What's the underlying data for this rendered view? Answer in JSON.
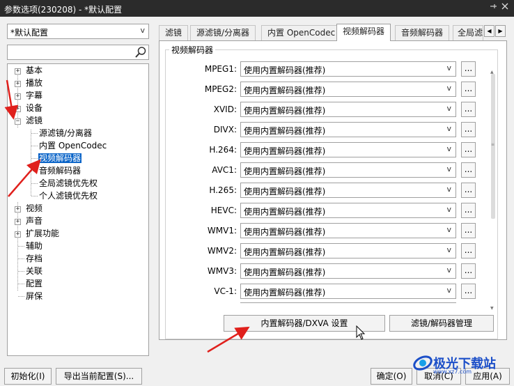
{
  "window": {
    "title": "参数选项(230208) - *默认配置",
    "pin_icon": "pin-icon",
    "close_icon": "close-icon"
  },
  "preset": {
    "value": "*默认配置"
  },
  "search": {
    "placeholder": ""
  },
  "tree": {
    "items": [
      {
        "label": "基本",
        "expander": "+"
      },
      {
        "label": "播放",
        "expander": "+"
      },
      {
        "label": "字幕",
        "expander": "+"
      },
      {
        "label": "设备",
        "expander": "+"
      },
      {
        "label": "滤镜",
        "expander": "−"
      },
      {
        "label": "源滤镜/分离器"
      },
      {
        "label": "内置 OpenCodec"
      },
      {
        "label": "视频解码器",
        "selected": true
      },
      {
        "label": "音频解码器"
      },
      {
        "label": "全局滤镜优先权"
      },
      {
        "label": "个人滤镜优先权"
      },
      {
        "label": "视频",
        "expander": "+"
      },
      {
        "label": "声音",
        "expander": "+"
      },
      {
        "label": "扩展功能",
        "expander": "+"
      },
      {
        "label": "辅助"
      },
      {
        "label": "存档"
      },
      {
        "label": "关联"
      },
      {
        "label": "配置"
      },
      {
        "label": "屏保"
      }
    ]
  },
  "tabs": [
    {
      "label": "滤镜"
    },
    {
      "label": "源滤镜/分离器"
    },
    {
      "label": "内置 OpenCodec"
    },
    {
      "label": "视频解码器",
      "active": true
    },
    {
      "label": "音频解码器"
    },
    {
      "label": "全局滤"
    }
  ],
  "panel": {
    "group_title": "视频解码器",
    "rows": [
      {
        "label": "MPEG1:",
        "value": "使用内置解码器(推荐)"
      },
      {
        "label": "MPEG2:",
        "value": "使用内置解码器(推荐)"
      },
      {
        "label": "XVID:",
        "value": "使用内置解码器(推荐)"
      },
      {
        "label": "DIVX:",
        "value": "使用内置解码器(推荐)"
      },
      {
        "label": "H.264:",
        "value": "使用内置解码器(推荐)"
      },
      {
        "label": "AVC1:",
        "value": "使用内置解码器(推荐)"
      },
      {
        "label": "H.265:",
        "value": "使用内置解码器(推荐)"
      },
      {
        "label": "HEVC:",
        "value": "使用内置解码器(推荐)"
      },
      {
        "label": "WMV1:",
        "value": "使用内置解码器(推荐)"
      },
      {
        "label": "WMV2:",
        "value": "使用内置解码器(推荐)"
      },
      {
        "label": "WMV3:",
        "value": "使用内置解码器(推荐)"
      },
      {
        "label": "VC-1:",
        "value": "使用内置解码器(推荐)"
      }
    ],
    "more_label": "...",
    "dxva_button": "内置解码器/DXVA 设置",
    "manage_button": "滤镜/解码器管理"
  },
  "footer": {
    "init_button": "初始化(I)",
    "export_button": "导出当前配置(S)...",
    "ok_button": "确定(O)",
    "cancel_button": "取消(C)",
    "apply_button": "应用(A)"
  },
  "watermark": {
    "brand": "极光下载站",
    "url": "www.xz7.com"
  },
  "colors": {
    "selection": "#0a64c8",
    "annotation_arrow": "#e0201c",
    "title_bar": "#2b2b2b"
  }
}
